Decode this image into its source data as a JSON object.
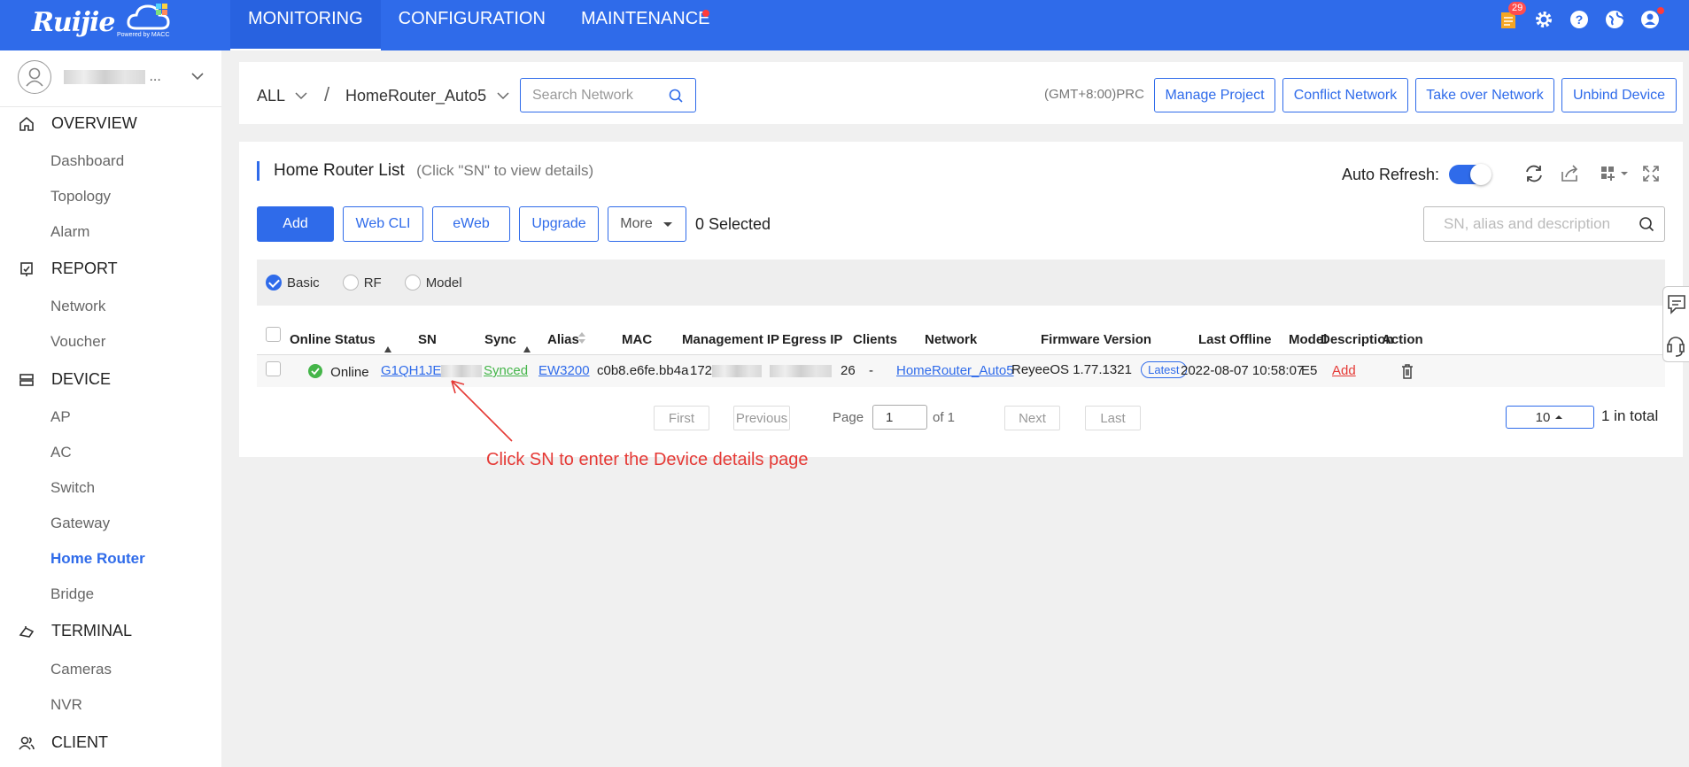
{
  "brand": {
    "logo_text": "Ruijie",
    "powered_by": "Powered by MACC"
  },
  "topnav": {
    "items": [
      {
        "label": "MONITORING",
        "active": true
      },
      {
        "label": "CONFIGURATION",
        "active": false
      },
      {
        "label": "MAINTENANCE",
        "active": false,
        "dot": true
      }
    ]
  },
  "top_icons": {
    "notification_count": "29",
    "icons": [
      "notification-icon",
      "settings-icon",
      "help-icon",
      "globe-icon",
      "user-icon"
    ]
  },
  "sidebar": {
    "user_suffix": "...",
    "groups": [
      {
        "label": "OVERVIEW",
        "icon": "home-icon",
        "items": [
          "Dashboard",
          "Topology",
          "Alarm"
        ]
      },
      {
        "label": "REPORT",
        "icon": "report-icon",
        "items": [
          "Network",
          "Voucher"
        ]
      },
      {
        "label": "DEVICE",
        "icon": "device-icon",
        "items": [
          "AP",
          "AC",
          "Switch",
          "Gateway",
          "Home Router",
          "Bridge"
        ]
      },
      {
        "label": "TERMINAL",
        "icon": "terminal-icon",
        "items": [
          "Cameras",
          "NVR"
        ]
      },
      {
        "label": "CLIENT",
        "icon": "client-icon",
        "items": []
      }
    ],
    "active_item": "Home Router"
  },
  "header": {
    "scope": "ALL",
    "separator": "/",
    "network": "HomeRouter_Auto5",
    "search_placeholder": "Search Network",
    "timezone": "(GMT+8:00)PRC",
    "buttons": [
      "Manage Project",
      "Conflict Network",
      "Take over Network",
      "Unbind Device"
    ]
  },
  "list": {
    "title": "Home Router List",
    "hint": "(Click \"SN\" to view details)",
    "auto_refresh_label": "Auto Refresh:",
    "auto_refresh_on": true,
    "actions": {
      "add": "Add",
      "webcli": "Web CLI",
      "eweb": "eWeb",
      "upgrade": "Upgrade",
      "more": "More"
    },
    "selected": "0 Selected",
    "search_placeholder": "SN, alias and description",
    "views": [
      {
        "label": "Basic",
        "checked": true
      },
      {
        "label": "RF",
        "checked": false
      },
      {
        "label": "Model",
        "checked": false
      }
    ],
    "columns": [
      "Online Status",
      "SN",
      "Sync",
      "Alias",
      "MAC",
      "Management IP",
      "Egress IP",
      "Clients",
      "Network",
      "Firmware Version",
      "Last Offline",
      "Model",
      "Description",
      "Action"
    ],
    "rows": [
      {
        "status": "Online",
        "sn": "G1QH1JE",
        "sync": "Synced",
        "alias": "EW3200",
        "mac": "c0b8.e6fe.bb4a",
        "mgmt_ip": "172",
        "egress_ip": "26",
        "clients": "-",
        "network": "HomeRouter_Auto5",
        "firmware": "ReyeeOS 1.77.1321",
        "firmware_tag": "Latest",
        "last_offline": "2022-08-07 10:58:07",
        "model": "E5",
        "description": "Add"
      }
    ]
  },
  "pagination": {
    "first": "First",
    "previous": "Previous",
    "page_label": "Page",
    "page": "1",
    "of": "of 1",
    "next": "Next",
    "last": "Last",
    "page_size": "10",
    "total": "1 in total"
  },
  "annotation": {
    "text": "Click SN to enter the Device details page",
    "color": "#e53935"
  },
  "colors": {
    "primary": "#2f6bea",
    "success": "#44b549",
    "danger": "#e53935"
  }
}
